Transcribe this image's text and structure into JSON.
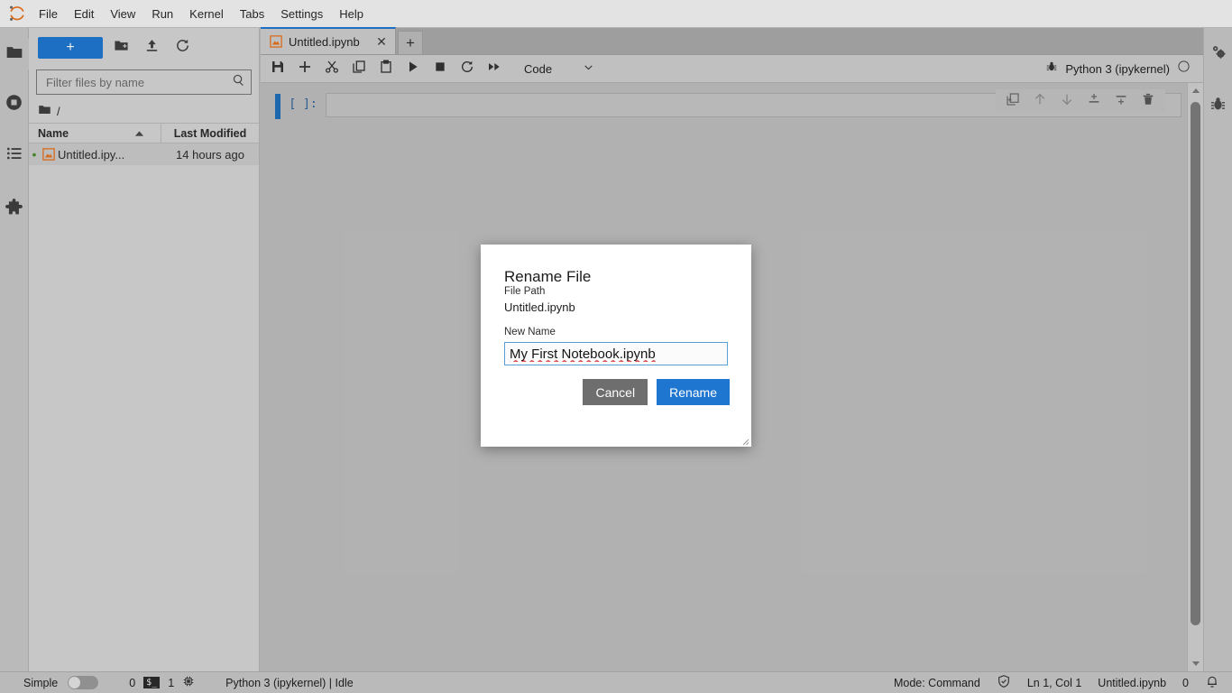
{
  "app": {
    "logo_icon": "jupyter-logo-icon",
    "menu": [
      "File",
      "Edit",
      "View",
      "Run",
      "Kernel",
      "Tabs",
      "Settings",
      "Help"
    ]
  },
  "left_activity_bar": {
    "items": [
      {
        "name": "file-browser",
        "icon": "folder-icon",
        "selected": true
      },
      {
        "name": "running-terminals-and-kernels",
        "icon": "stop-circle-icon",
        "selected": false
      },
      {
        "name": "commands",
        "icon": "list-icon",
        "selected": false
      },
      {
        "name": "extension-manager",
        "icon": "puzzle-piece-icon",
        "selected": false
      }
    ]
  },
  "right_activity_bar": {
    "items": [
      {
        "name": "property-inspector",
        "icon": "gears-icon"
      },
      {
        "name": "debugger",
        "icon": "bug-icon"
      }
    ]
  },
  "file_browser": {
    "new_launcher_label": "+",
    "toolbar": [
      {
        "name": "new-folder-button",
        "icon": "new-folder-icon"
      },
      {
        "name": "upload-button",
        "icon": "upload-icon"
      },
      {
        "name": "refresh-button",
        "icon": "refresh-icon"
      }
    ],
    "filter": {
      "placeholder": "Filter files by name",
      "value": "",
      "icon": "search-icon"
    },
    "breadcrumb": {
      "icon": "folder-icon",
      "path": "/"
    },
    "columns": {
      "name": "Name",
      "last_modified": "Last Modified"
    },
    "sort": {
      "column": "Name",
      "direction": "ascending"
    },
    "files": [
      {
        "name": "Untitled.ipy...",
        "last_modified": "14 hours ago",
        "icon": "notebook-icon",
        "unsaved_dot": true
      }
    ]
  },
  "main": {
    "tabs": [
      {
        "label": "Untitled.ipynb",
        "icon": "notebook-icon",
        "active": true,
        "close_icon": "close-icon"
      }
    ],
    "add_tab_label": "+",
    "notebook_toolbar": {
      "buttons": [
        {
          "name": "save-button",
          "icon": "save-icon"
        },
        {
          "name": "insert-cell-button",
          "icon": "plus-icon"
        },
        {
          "name": "cut-button",
          "icon": "scissors-icon"
        },
        {
          "name": "copy-button",
          "icon": "copy-icon"
        },
        {
          "name": "paste-button",
          "icon": "paste-icon"
        },
        {
          "name": "run-button",
          "icon": "play-icon"
        },
        {
          "name": "interrupt-button",
          "icon": "stop-square-icon"
        },
        {
          "name": "restart-button",
          "icon": "restart-icon"
        },
        {
          "name": "restart-and-run-all-button",
          "icon": "fast-forward-icon"
        }
      ],
      "cell_type": "Code",
      "cell_type_caret": "chevron-down-icon",
      "kernel_status_icon": "bug-icon",
      "kernel_name": "Python 3 (ipykernel)",
      "kernel_busy_icon": "idle-circle-icon"
    },
    "cell": {
      "prompt": "[ ]:",
      "source": "",
      "toolbar": [
        {
          "name": "duplicate-cell-button",
          "icon": "duplicate-icon"
        },
        {
          "name": "move-cell-up-button",
          "icon": "arrow-up-icon"
        },
        {
          "name": "move-cell-down-button",
          "icon": "arrow-down-icon"
        },
        {
          "name": "insert-cell-above-button",
          "icon": "insert-above-icon"
        },
        {
          "name": "insert-cell-below-button",
          "icon": "insert-below-icon"
        },
        {
          "name": "delete-cell-button",
          "icon": "trash-icon"
        }
      ]
    }
  },
  "dialog": {
    "title": "Rename File",
    "file_path_label": "File Path",
    "file_path_value": "Untitled.ipynb",
    "new_name_label": "New Name",
    "new_name_value": "My First Notebook.ipynb",
    "cancel_label": "Cancel",
    "rename_label": "Rename",
    "resize_grip": "resize-grip-icon"
  },
  "status_bar": {
    "simple_label": "Simple",
    "simple_enabled": false,
    "terminals_count": "0",
    "terminal_icon": "terminal-icon",
    "kernels_count": "1",
    "kernel_icon": "cpu-icon",
    "kernel_status": "Python 3 (ipykernel) | Idle",
    "mode": "Mode: Command",
    "trust_icon": "shield-check-icon",
    "cursor_position": "Ln 1, Col 1",
    "active_file": "Untitled.ipynb",
    "notification_count": "0",
    "notification_icon": "bell-icon"
  },
  "colors": {
    "accent_blue": "#1e76d0",
    "cell_active_blue": "#1e6eb8",
    "cancel_grey": "#6e6e6e",
    "notebook_icon_orange": "#e8711a",
    "unsaved_dot_green": "#4c8c2b"
  }
}
